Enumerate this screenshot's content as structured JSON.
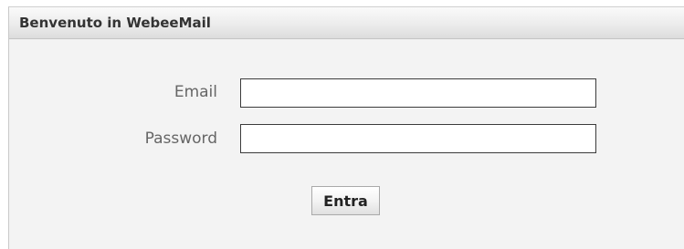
{
  "panel": {
    "title": "Benvenuto in WebeeMail"
  },
  "login_form": {
    "email_label": "Email",
    "email_value": "",
    "password_label": "Password",
    "password_value": "",
    "submit_label": "Entra"
  }
}
